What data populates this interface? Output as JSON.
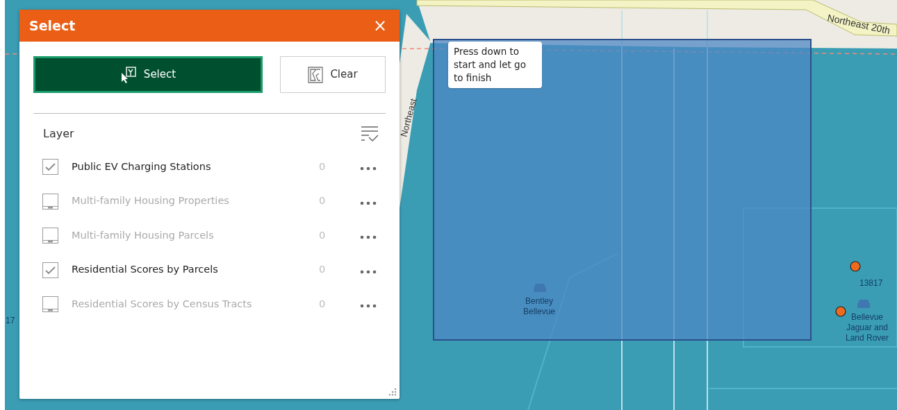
{
  "panel": {
    "title": "Select",
    "close": "×"
  },
  "buttons": [
    {
      "label": "Select",
      "selected": true
    },
    {
      "label": "Clear",
      "selected": false
    }
  ],
  "layer_header": "Layer",
  "layers": [
    {
      "name": "Public EV Charging Stations",
      "count": "0",
      "checked": true,
      "disabled": false
    },
    {
      "name": "Multi-family Housing Properties",
      "count": "0",
      "checked": false,
      "disabled": true
    },
    {
      "name": "Multi-family Housing Parcels",
      "count": "0",
      "checked": false,
      "disabled": true
    },
    {
      "name": "Residential Scores by Parcels",
      "count": "0",
      "checked": true,
      "disabled": false
    },
    {
      "name": "Residential Scores by Census Tracts",
      "count": "0",
      "checked": false,
      "disabled": true
    }
  ],
  "tooltip": "Press down to start and let go to finish",
  "map_labels": [
    {
      "kind": "street",
      "text": "Northeast 20th"
    },
    {
      "kind": "street-vertical",
      "text": "Northeast"
    },
    {
      "kind": "number-edge",
      "text": "17"
    },
    {
      "kind": "poi",
      "text": "Bentley Bellevue"
    },
    {
      "kind": "number",
      "text": "13817"
    },
    {
      "kind": "poi",
      "text": "Bellevue Jaguar and Land Rover"
    }
  ]
}
